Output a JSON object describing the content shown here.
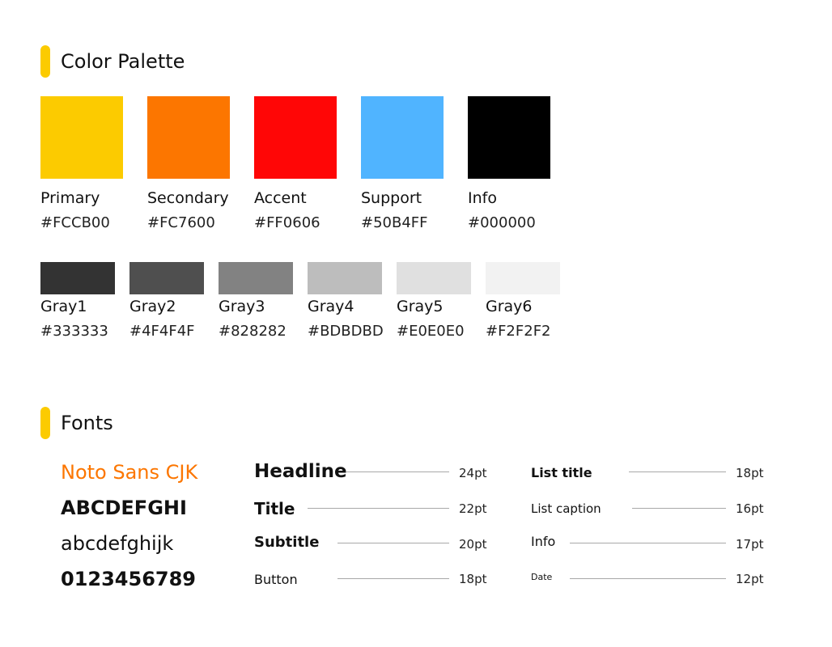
{
  "palette": {
    "title": "Color Palette",
    "main_colors": [
      {
        "name": "Primary",
        "hex": "#FCCB00"
      },
      {
        "name": "Secondary",
        "hex": "#FC7600"
      },
      {
        "name": "Accent",
        "hex": "#FF0606"
      },
      {
        "name": "Support",
        "hex": "#50B4FF"
      },
      {
        "name": "Info",
        "hex": "#000000"
      }
    ],
    "gray_colors": [
      {
        "name": "Gray1",
        "hex": "#333333"
      },
      {
        "name": "Gray2",
        "hex": "#4F4F4F"
      },
      {
        "name": "Gray3",
        "hex": "#828282"
      },
      {
        "name": "Gray4",
        "hex": "#BDBDBD"
      },
      {
        "name": "Gray5",
        "hex": "#E0E0E0"
      },
      {
        "name": "Gray6",
        "hex": "#F2F2F2"
      }
    ]
  },
  "fonts": {
    "title": "Fonts",
    "font_name": "Noto Sans CJK",
    "uppercase_sample": "ABCDEFGHI",
    "lowercase_sample": "abcdefghijk",
    "digits_sample": "0123456789",
    "type_scale_left": [
      {
        "label": "Headline",
        "size": "24pt"
      },
      {
        "label": "Title",
        "size": "22pt"
      },
      {
        "label": "Subtitle",
        "size": "20pt"
      },
      {
        "label": "Button",
        "size": "18pt"
      }
    ],
    "type_scale_right": [
      {
        "label": "List title",
        "size": "18pt"
      },
      {
        "label": "List caption",
        "size": "16pt"
      },
      {
        "label": "Info",
        "size": "17pt"
      },
      {
        "label": "Date",
        "size": "12pt"
      }
    ]
  },
  "colors": {
    "section_accent": "#FCCB00",
    "font_name_color": "#FC7600"
  }
}
